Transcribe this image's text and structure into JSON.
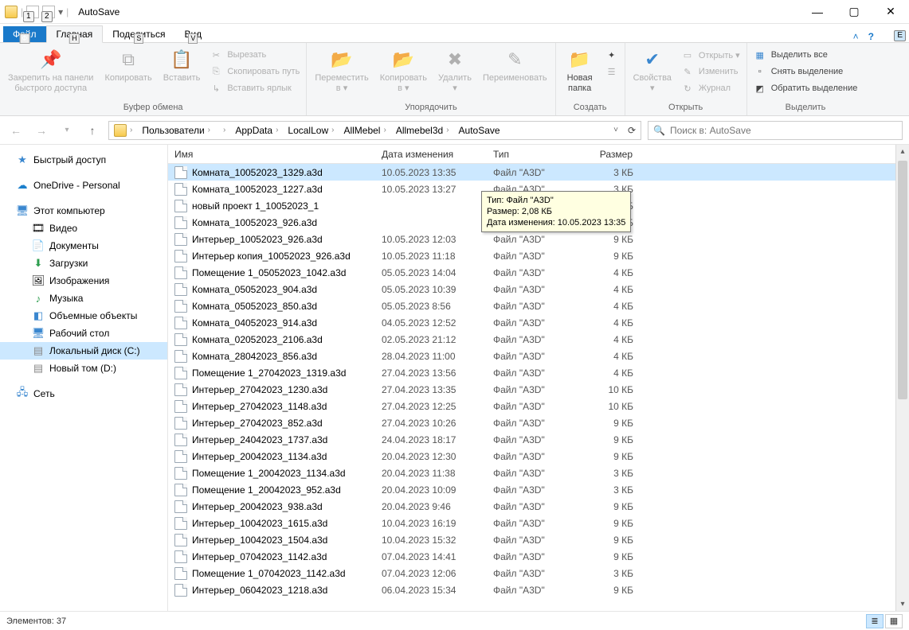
{
  "window": {
    "title": "AutoSave"
  },
  "qat_badges": [
    "1",
    "2"
  ],
  "ribbon_tabs": {
    "file": "Файл",
    "home": "Главная",
    "share": "Поделиться",
    "view": "Вид",
    "keytips": {
      "file": "Ф",
      "home": "H",
      "share": "S",
      "view": "V"
    }
  },
  "ribbon": {
    "clipboard": {
      "pin": "Закрепить на панели\nбыстрого доступа",
      "copy": "Копировать",
      "paste": "Вставить",
      "cut": "Вырезать",
      "copy_path": "Скопировать путь",
      "paste_shortcut": "Вставить ярлык",
      "group": "Буфер обмена"
    },
    "organize": {
      "move_to": "Переместить\nв ▾",
      "copy_to": "Копировать\nв ▾",
      "delete": "Удалить\n▾",
      "rename": "Переименовать",
      "group": "Упорядочить"
    },
    "new": {
      "new_folder": "Новая\nпапка",
      "new_item": "Создать элемент",
      "easy_access": "Простой доступ",
      "group": "Создать"
    },
    "open": {
      "properties": "Свойства\n▾",
      "open": "Открыть ▾",
      "edit": "Изменить",
      "history": "Журнал",
      "group": "Открыть"
    },
    "select": {
      "select_all": "Выделить все",
      "select_none": "Снять выделение",
      "invert": "Обратить выделение",
      "group": "Выделить"
    }
  },
  "breadcrumb": [
    "Пользователи",
    "",
    "AppData",
    "LocalLow",
    "AllMebel",
    "Allmebel3d",
    "AutoSave"
  ],
  "search_placeholder": "Поиск в: AutoSave",
  "nav": {
    "quick_access": "Быстрый доступ",
    "onedrive": "OneDrive - Personal",
    "this_pc": "Этот компьютер",
    "videos": "Видео",
    "documents": "Документы",
    "downloads": "Загрузки",
    "pictures": "Изображения",
    "music": "Музыка",
    "objects3d": "Объемные объекты",
    "desktop": "Рабочий стол",
    "local_disk": "Локальный диск (C:)",
    "new_volume": "Новый том (D:)",
    "network": "Сеть"
  },
  "columns": {
    "name": "Имя",
    "date": "Дата изменения",
    "type": "Тип",
    "size": "Размер"
  },
  "file_type": "Файл \"A3D\"",
  "files": [
    {
      "name": "Комната_10052023_1329.a3d",
      "date": "10.05.2023 13:35",
      "size": "3 КБ",
      "sel": true
    },
    {
      "name": "Комната_10052023_1227.a3d",
      "date": "10.05.2023 13:27",
      "size": "3 КБ"
    },
    {
      "name": "новый проект 1_10052023_1",
      "date": "",
      "size": "3 КБ"
    },
    {
      "name": "Комната_10052023_926.a3d",
      "date": "",
      "size": "3 КБ"
    },
    {
      "name": "Интерьер_10052023_926.a3d",
      "date": "10.05.2023 12:03",
      "size": "9 КБ"
    },
    {
      "name": "Интерьер копия_10052023_926.a3d",
      "date": "10.05.2023 11:18",
      "size": "9 КБ"
    },
    {
      "name": "Помещение 1_05052023_1042.a3d",
      "date": "05.05.2023 14:04",
      "size": "4 КБ"
    },
    {
      "name": "Комната_05052023_904.a3d",
      "date": "05.05.2023 10:39",
      "size": "4 КБ"
    },
    {
      "name": "Комната_05052023_850.a3d",
      "date": "05.05.2023 8:56",
      "size": "4 КБ"
    },
    {
      "name": "Комната_04052023_914.a3d",
      "date": "04.05.2023 12:52",
      "size": "4 КБ"
    },
    {
      "name": "Комната_02052023_2106.a3d",
      "date": "02.05.2023 21:12",
      "size": "4 КБ"
    },
    {
      "name": "Комната_28042023_856.a3d",
      "date": "28.04.2023 11:00",
      "size": "4 КБ"
    },
    {
      "name": "Помещение 1_27042023_1319.a3d",
      "date": "27.04.2023 13:56",
      "size": "4 КБ"
    },
    {
      "name": "Интерьер_27042023_1230.a3d",
      "date": "27.04.2023 13:35",
      "size": "10 КБ"
    },
    {
      "name": "Интерьер_27042023_1148.a3d",
      "date": "27.04.2023 12:25",
      "size": "10 КБ"
    },
    {
      "name": "Интерьер_27042023_852.a3d",
      "date": "27.04.2023 10:26",
      "size": "9 КБ"
    },
    {
      "name": "Интерьер_24042023_1737.a3d",
      "date": "24.04.2023 18:17",
      "size": "9 КБ"
    },
    {
      "name": "Интерьер_20042023_1134.a3d",
      "date": "20.04.2023 12:30",
      "size": "9 КБ"
    },
    {
      "name": "Помещение 1_20042023_1134.a3d",
      "date": "20.04.2023 11:38",
      "size": "3 КБ"
    },
    {
      "name": "Помещение 1_20042023_952.a3d",
      "date": "20.04.2023 10:09",
      "size": "3 КБ"
    },
    {
      "name": "Интерьер_20042023_938.a3d",
      "date": "20.04.2023 9:46",
      "size": "9 КБ"
    },
    {
      "name": "Интерьер_10042023_1615.a3d",
      "date": "10.04.2023 16:19",
      "size": "9 КБ"
    },
    {
      "name": "Интерьер_10042023_1504.a3d",
      "date": "10.04.2023 15:32",
      "size": "9 КБ"
    },
    {
      "name": "Интерьер_07042023_1142.a3d",
      "date": "07.04.2023 14:41",
      "size": "9 КБ"
    },
    {
      "name": "Помещение 1_07042023_1142.a3d",
      "date": "07.04.2023 12:06",
      "size": "3 КБ"
    },
    {
      "name": "Интерьер_06042023_1218.a3d",
      "date": "06.04.2023 15:34",
      "size": "9 КБ"
    }
  ],
  "tooltip": {
    "line1": "Тип: Файл \"A3D\"",
    "line2": "Размер: 2,08 КБ",
    "line3": "Дата изменения: 10.05.2023 13:35"
  },
  "status": {
    "items": "Элементов: 37"
  },
  "keytip_e": "E"
}
